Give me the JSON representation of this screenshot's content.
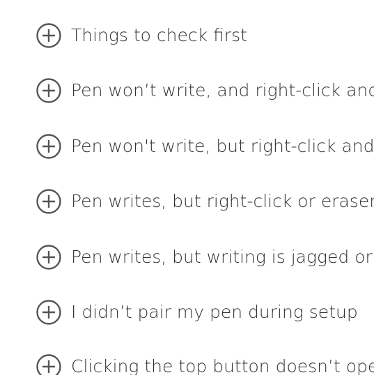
{
  "accordion": {
    "items": [
      {
        "label": "Things to check first"
      },
      {
        "label": "Pen won’t write, and right-click and eraser buttons don’t work"
      },
      {
        "label": "Pen won't write, but right-click and eraser buttons work"
      },
      {
        "label": "Pen writes, but right-click or eraser buttons don’t work"
      },
      {
        "label": "Pen writes, but writing is jagged or inaccurate"
      },
      {
        "label": "I didn’t pair my pen during setup"
      },
      {
        "label": "Clicking the top button doesn’t open OneNote"
      }
    ],
    "icon": "plus-circle-icon",
    "colors": {
      "text": "#333333",
      "icon": "#555555",
      "background": "#ffffff"
    }
  }
}
